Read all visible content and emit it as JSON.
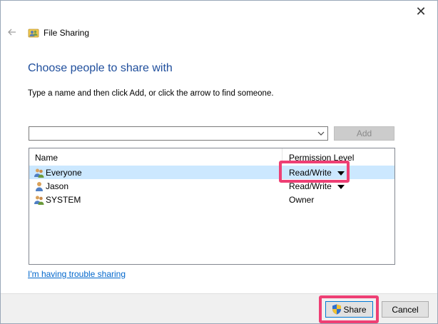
{
  "window": {
    "title": "File Sharing",
    "close_glyph": "✕"
  },
  "dialog": {
    "heading": "Choose people to share with",
    "instruction": "Type a name and then click Add, or click the arrow to find someone.",
    "name_input": {
      "value": "",
      "placeholder": ""
    },
    "add_label": "Add"
  },
  "list": {
    "columns": {
      "name": "Name",
      "permission": "Permission Level"
    },
    "rows": [
      {
        "name": "Everyone",
        "permission": "Read/Write",
        "icon": "group-users-icon",
        "selected": true,
        "has_dropdown": true
      },
      {
        "name": "Jason",
        "permission": "Read/Write",
        "icon": "user-icon",
        "selected": false,
        "has_dropdown": true
      },
      {
        "name": "SYSTEM",
        "permission": "Owner",
        "icon": "group-users-icon",
        "selected": false,
        "has_dropdown": false
      }
    ]
  },
  "links": {
    "trouble": "I'm having trouble sharing"
  },
  "footer": {
    "share_label": "Share",
    "cancel_label": "Cancel"
  },
  "colors": {
    "heading": "#1f4e9c",
    "selected_row": "#cce8ff",
    "highlight": "#ee3f74",
    "link": "#0066cc"
  }
}
